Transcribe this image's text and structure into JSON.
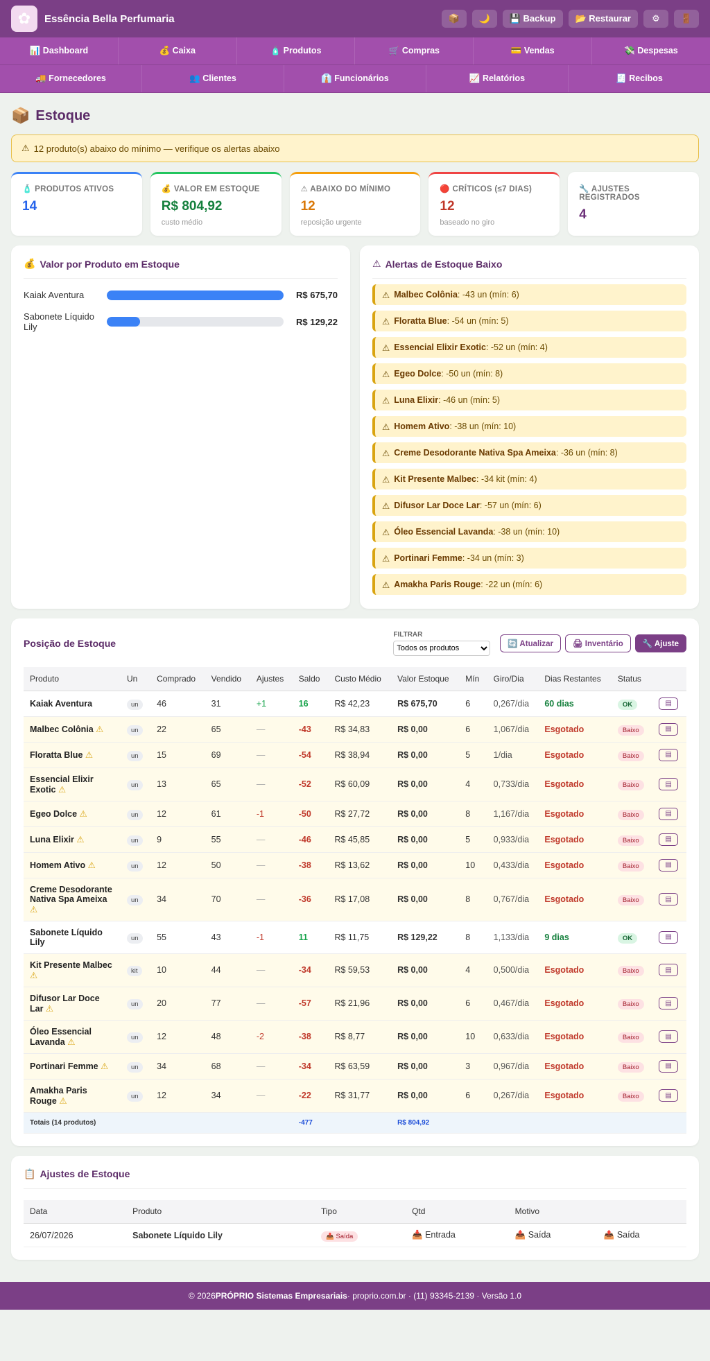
{
  "header": {
    "brand": "Essência Bella Perfumaria",
    "logo_icon": "flower-icon",
    "actions": [
      {
        "name": "box",
        "label": "📦",
        "icon": true
      },
      {
        "name": "theme",
        "label": "🌙",
        "icon": true
      },
      {
        "name": "backup",
        "label": "💾 Backup",
        "icon": false
      },
      {
        "name": "restore",
        "label": "📂 Restaurar",
        "icon": false
      },
      {
        "name": "settings",
        "label": "⚙",
        "icon": true
      },
      {
        "name": "exit",
        "label": "🚪",
        "icon": true
      }
    ]
  },
  "nav_row1": [
    "📊 Dashboard",
    "💰 Caixa",
    "🧴 Produtos",
    "🛒 Compras",
    "💳 Vendas",
    "💸 Despesas"
  ],
  "nav_row2": [
    "🚚 Fornecedores",
    "👥 Clientes",
    "👔 Funcionários",
    "📈 Relatórios",
    "🧾 Recibos"
  ],
  "page": {
    "title": "Estoque",
    "banner": "12 produto(s) abaixo do mínimo — verifique os alertas abaixo"
  },
  "kpis": [
    {
      "label": "🧴 PRODUTOS ATIVOS",
      "value": "14",
      "sub": "",
      "color": "#2563eb",
      "border": "#3b82f6"
    },
    {
      "label": "💰 VALOR EM ESTOQUE",
      "value": "R$ 804,92",
      "sub": "custo médio",
      "color": "#15803d",
      "border": "#22c55e"
    },
    {
      "label": "⚠ ABAIXO DO MÍNIMO",
      "value": "12",
      "sub": "reposição urgente",
      "color": "#d97706",
      "border": "#f59e0b"
    },
    {
      "label": "🔴 CRÍTICOS (≤7 DIAS)",
      "value": "12",
      "sub": "baseado no giro",
      "color": "#c0392b",
      "border": "#ef4444"
    },
    {
      "label": "🔧 AJUSTES REGISTRADOS",
      "value": "4",
      "sub": "",
      "color": "#6b2f78",
      "border": "#ffffff"
    }
  ],
  "value_chart": {
    "title": "Valor por Produto em Estoque",
    "items": [
      {
        "name": "Kaiak Aventura",
        "value": "R$ 675,70",
        "fraction": 1.0
      },
      {
        "name": "Sabonete Líquido Lily",
        "value": "R$ 129,22",
        "fraction": 0.19
      }
    ]
  },
  "alerts": {
    "title": "Alertas de Estoque Baixo",
    "items": [
      {
        "name": "Malbec Colônia",
        "detail": ": -43 un (mín: 6)"
      },
      {
        "name": "Floratta Blue",
        "detail": ": -54 un (mín: 5)"
      },
      {
        "name": "Essencial Elixir Exotic",
        "detail": ": -52 un (mín: 4)"
      },
      {
        "name": "Egeo Dolce",
        "detail": ": -50 un (mín: 8)"
      },
      {
        "name": "Luna Elixir",
        "detail": ": -46 un (mín: 5)"
      },
      {
        "name": "Homem Ativo",
        "detail": ": -38 un (mín: 10)"
      },
      {
        "name": "Creme Desodorante Nativa Spa Ameixa",
        "detail": ": -36 un (mín: 8)"
      },
      {
        "name": "Kit Presente Malbec",
        "detail": ": -34 kit (mín: 4)"
      },
      {
        "name": "Difusor Lar Doce Lar",
        "detail": ": -57 un (mín: 6)"
      },
      {
        "name": "Óleo Essencial Lavanda",
        "detail": ": -38 un (mín: 10)"
      },
      {
        "name": "Portinari Femme",
        "detail": ": -34 un (mín: 3)"
      },
      {
        "name": "Amakha Paris Rouge",
        "detail": ": -22 un (mín: 6)"
      }
    ]
  },
  "stock_table": {
    "title": "Posição de Estoque",
    "filter_label": "FILTRAR",
    "filter_value": "Todos os produtos",
    "buttons": {
      "refresh": "🔄 Atualizar",
      "inventory": "🖨 Inventário",
      "adjust": "🔧 Ajuste"
    },
    "columns": [
      "Produto",
      "Un",
      "Comprado",
      "Vendido",
      "Ajustes",
      "Saldo",
      "Custo Médio",
      "Valor Estoque",
      "Mín",
      "Giro/Dia",
      "Dias Restantes",
      "Status",
      ""
    ],
    "rows": [
      {
        "produto": "Kaiak Aventura",
        "warn": false,
        "un": "un",
        "comprado": "46",
        "vendido": "31",
        "ajustes": "+1",
        "ajuste_tipo": "pos",
        "saldo": "16",
        "custo": "R$ 42,23",
        "valor": "R$ 675,70",
        "min": "6",
        "giro": "0,267/dia",
        "dias": "60 dias",
        "status": "OK"
      },
      {
        "produto": "Malbec Colônia",
        "warn": true,
        "un": "un",
        "comprado": "22",
        "vendido": "65",
        "ajustes": "—",
        "ajuste_tipo": "none",
        "saldo": "-43",
        "custo": "R$ 34,83",
        "valor": "R$ 0,00",
        "min": "6",
        "giro": "1,067/dia",
        "dias": "Esgotado",
        "status": "Baixo"
      },
      {
        "produto": "Floratta Blue",
        "warn": true,
        "un": "un",
        "comprado": "15",
        "vendido": "69",
        "ajustes": "—",
        "ajuste_tipo": "none",
        "saldo": "-54",
        "custo": "R$ 38,94",
        "valor": "R$ 0,00",
        "min": "5",
        "giro": "1/dia",
        "dias": "Esgotado",
        "status": "Baixo"
      },
      {
        "produto": "Essencial Elixir Exotic",
        "warn": true,
        "un": "un",
        "comprado": "13",
        "vendido": "65",
        "ajustes": "—",
        "ajuste_tipo": "none",
        "saldo": "-52",
        "custo": "R$ 60,09",
        "valor": "R$ 0,00",
        "min": "4",
        "giro": "0,733/dia",
        "dias": "Esgotado",
        "status": "Baixo"
      },
      {
        "produto": "Egeo Dolce",
        "warn": true,
        "un": "un",
        "comprado": "12",
        "vendido": "61",
        "ajustes": "-1",
        "ajuste_tipo": "neg",
        "saldo": "-50",
        "custo": "R$ 27,72",
        "valor": "R$ 0,00",
        "min": "8",
        "giro": "1,167/dia",
        "dias": "Esgotado",
        "status": "Baixo"
      },
      {
        "produto": "Luna Elixir",
        "warn": true,
        "un": "un",
        "comprado": "9",
        "vendido": "55",
        "ajustes": "—",
        "ajuste_tipo": "none",
        "saldo": "-46",
        "custo": "R$ 45,85",
        "valor": "R$ 0,00",
        "min": "5",
        "giro": "0,933/dia",
        "dias": "Esgotado",
        "status": "Baixo"
      },
      {
        "produto": "Homem Ativo",
        "warn": true,
        "un": "un",
        "comprado": "12",
        "vendido": "50",
        "ajustes": "—",
        "ajuste_tipo": "none",
        "saldo": "-38",
        "custo": "R$ 13,62",
        "valor": "R$ 0,00",
        "min": "10",
        "giro": "0,433/dia",
        "dias": "Esgotado",
        "status": "Baixo"
      },
      {
        "produto": "Creme Desodorante Nativa Spa Ameixa",
        "warn": true,
        "un": "un",
        "comprado": "34",
        "vendido": "70",
        "ajustes": "—",
        "ajuste_tipo": "none",
        "saldo": "-36",
        "custo": "R$ 17,08",
        "valor": "R$ 0,00",
        "min": "8",
        "giro": "0,767/dia",
        "dias": "Esgotado",
        "status": "Baixo"
      },
      {
        "produto": "Sabonete Líquido Lily",
        "warn": false,
        "un": "un",
        "comprado": "55",
        "vendido": "43",
        "ajustes": "-1",
        "ajuste_tipo": "neg",
        "saldo": "11",
        "custo": "R$ 11,75",
        "valor": "R$ 129,22",
        "min": "8",
        "giro": "1,133/dia",
        "dias": "9 dias",
        "status": "OK"
      },
      {
        "produto": "Kit Presente Malbec",
        "warn": true,
        "un": "kit",
        "comprado": "10",
        "vendido": "44",
        "ajustes": "—",
        "ajuste_tipo": "none",
        "saldo": "-34",
        "custo": "R$ 59,53",
        "valor": "R$ 0,00",
        "min": "4",
        "giro": "0,500/dia",
        "dias": "Esgotado",
        "status": "Baixo"
      },
      {
        "produto": "Difusor Lar Doce Lar",
        "warn": true,
        "un": "un",
        "comprado": "20",
        "vendido": "77",
        "ajustes": "—",
        "ajuste_tipo": "none",
        "saldo": "-57",
        "custo": "R$ 21,96",
        "valor": "R$ 0,00",
        "min": "6",
        "giro": "0,467/dia",
        "dias": "Esgotado",
        "status": "Baixo"
      },
      {
        "produto": "Óleo Essencial Lavanda",
        "warn": true,
        "un": "un",
        "comprado": "12",
        "vendido": "48",
        "ajustes": "-2",
        "ajuste_tipo": "neg",
        "saldo": "-38",
        "custo": "R$ 8,77",
        "valor": "R$ 0,00",
        "min": "10",
        "giro": "0,633/dia",
        "dias": "Esgotado",
        "status": "Baixo"
      },
      {
        "produto": "Portinari Femme",
        "warn": true,
        "un": "un",
        "comprado": "34",
        "vendido": "68",
        "ajustes": "—",
        "ajuste_tipo": "none",
        "saldo": "-34",
        "custo": "R$ 63,59",
        "valor": "R$ 0,00",
        "min": "3",
        "giro": "0,967/dia",
        "dias": "Esgotado",
        "status": "Baixo"
      },
      {
        "produto": "Amakha Paris Rouge",
        "warn": true,
        "un": "un",
        "comprado": "12",
        "vendido": "34",
        "ajustes": "—",
        "ajuste_tipo": "none",
        "saldo": "-22",
        "custo": "R$ 31,77",
        "valor": "R$ 0,00",
        "min": "6",
        "giro": "0,267/dia",
        "dias": "Esgotado",
        "status": "Baixo"
      }
    ],
    "totals": {
      "label": "Totais (14 produtos)",
      "saldo": "-477",
      "valor": "R$ 804,92"
    }
  },
  "adjustments": {
    "title": "Ajustes de Estoque",
    "columns": [
      "Data",
      "Produto",
      "Tipo",
      "Qtd",
      "Motivo",
      ""
    ],
    "rows": [
      {
        "data": "26/07/2026",
        "produto": "Sabonete Líquido Lily",
        "tipo": "📤 Saída",
        "qtd": "📥 Entrada",
        "motivo": "📤 Saída",
        "extra": "📤 Saída"
      }
    ]
  },
  "footer": {
    "copyright": "© 2026 ",
    "company": "PRÓPRIO Sistemas Empresariais",
    "rest": " · proprio.com.br · (11) 93345-2139 · Versão 1.0"
  }
}
